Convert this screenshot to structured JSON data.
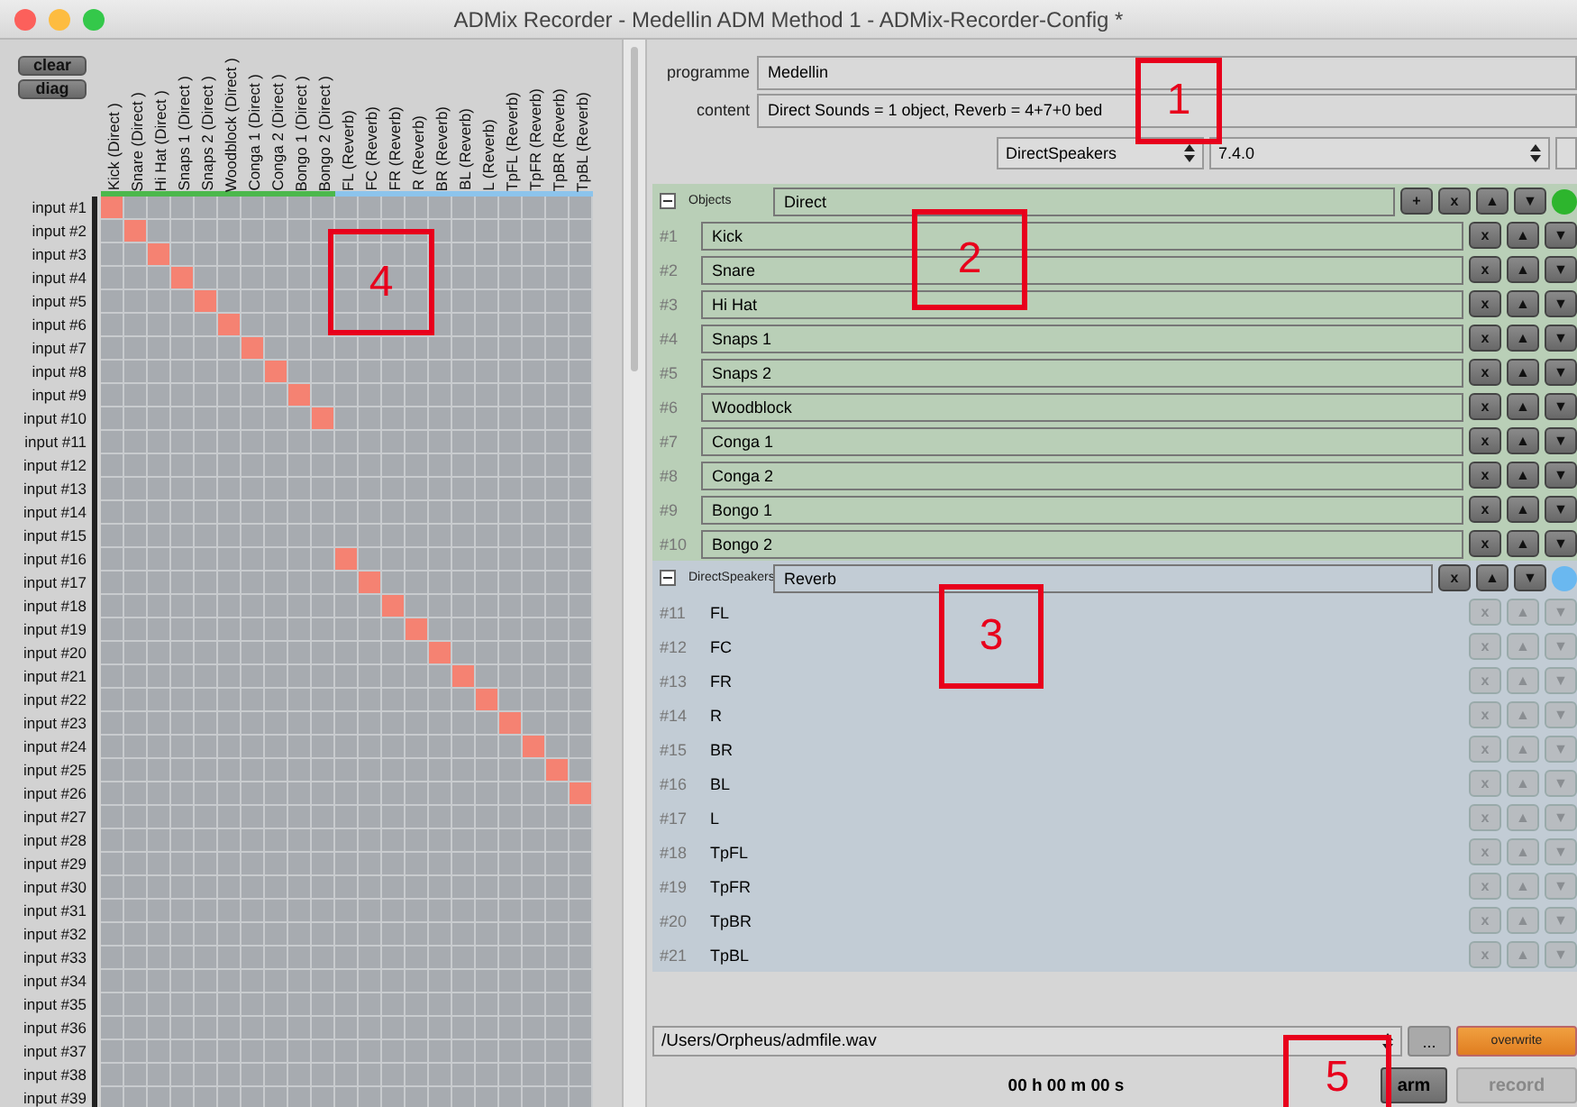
{
  "window": {
    "title": "ADMix Recorder - Medellin ADM Method 1 - ADMix-Recorder-Config *"
  },
  "matrix": {
    "buttons": [
      "clear",
      "diag"
    ],
    "columns": [
      {
        "label": "Kick (Direct )",
        "color": "#4cb84c"
      },
      {
        "label": "Snare (Direct )",
        "color": "#4cb84c"
      },
      {
        "label": "Hi Hat (Direct )",
        "color": "#4cb84c"
      },
      {
        "label": "Snaps 1 (Direct )",
        "color": "#4cb84c"
      },
      {
        "label": "Snaps 2 (Direct )",
        "color": "#4cb84c"
      },
      {
        "label": "Woodblock (Direct )",
        "color": "#4cb84c"
      },
      {
        "label": "Conga 1 (Direct )",
        "color": "#4cb84c"
      },
      {
        "label": "Conga 2 (Direct )",
        "color": "#4cb84c"
      },
      {
        "label": "Bongo 1 (Direct )",
        "color": "#4cb84c"
      },
      {
        "label": "Bongo 2 (Direct )",
        "color": "#4cb84c"
      },
      {
        "label": "FL (Reverb)",
        "color": "#8cc4ec"
      },
      {
        "label": "FC (Reverb)",
        "color": "#8cc4ec"
      },
      {
        "label": "FR (Reverb)",
        "color": "#8cc4ec"
      },
      {
        "label": "R (Reverb)",
        "color": "#8cc4ec"
      },
      {
        "label": "BR (Reverb)",
        "color": "#8cc4ec"
      },
      {
        "label": "BL (Reverb)",
        "color": "#8cc4ec"
      },
      {
        "label": "L (Reverb)",
        "color": "#8cc4ec"
      },
      {
        "label": "TpFL (Reverb)",
        "color": "#8cc4ec"
      },
      {
        "label": "TpFR (Reverb)",
        "color": "#8cc4ec"
      },
      {
        "label": "TpBR (Reverb)",
        "color": "#8cc4ec"
      },
      {
        "label": "TpBL (Reverb)",
        "color": "#8cc4ec"
      }
    ],
    "rows": [
      {
        "label": "input #1",
        "cells": [
          true,
          false,
          false,
          false,
          false,
          false,
          false,
          false,
          false,
          false,
          false,
          false,
          false,
          false,
          false,
          false,
          false,
          false,
          false,
          false,
          false
        ]
      },
      {
        "label": "input #2",
        "cells": [
          false,
          true,
          false,
          false,
          false,
          false,
          false,
          false,
          false,
          false,
          false,
          false,
          false,
          false,
          false,
          false,
          false,
          false,
          false,
          false,
          false
        ]
      },
      {
        "label": "input #3",
        "cells": [
          false,
          false,
          true,
          false,
          false,
          false,
          false,
          false,
          false,
          false,
          false,
          false,
          false,
          false,
          false,
          false,
          false,
          false,
          false,
          false,
          false
        ]
      },
      {
        "label": "input #4",
        "cells": [
          false,
          false,
          false,
          true,
          false,
          false,
          false,
          false,
          false,
          false,
          false,
          false,
          false,
          false,
          false,
          false,
          false,
          false,
          false,
          false,
          false
        ]
      },
      {
        "label": "input #5",
        "cells": [
          false,
          false,
          false,
          false,
          true,
          false,
          false,
          false,
          false,
          false,
          false,
          false,
          false,
          false,
          false,
          false,
          false,
          false,
          false,
          false,
          false
        ]
      },
      {
        "label": "input #6",
        "cells": [
          false,
          false,
          false,
          false,
          false,
          true,
          false,
          false,
          false,
          false,
          false,
          false,
          false,
          false,
          false,
          false,
          false,
          false,
          false,
          false,
          false
        ]
      },
      {
        "label": "input #7",
        "cells": [
          false,
          false,
          false,
          false,
          false,
          false,
          true,
          false,
          false,
          false,
          false,
          false,
          false,
          false,
          false,
          false,
          false,
          false,
          false,
          false,
          false
        ]
      },
      {
        "label": "input #8",
        "cells": [
          false,
          false,
          false,
          false,
          false,
          false,
          false,
          true,
          false,
          false,
          false,
          false,
          false,
          false,
          false,
          false,
          false,
          false,
          false,
          false,
          false
        ]
      },
      {
        "label": "input #9",
        "cells": [
          false,
          false,
          false,
          false,
          false,
          false,
          false,
          false,
          true,
          false,
          false,
          false,
          false,
          false,
          false,
          false,
          false,
          false,
          false,
          false,
          false
        ]
      },
      {
        "label": "input #10",
        "cells": [
          false,
          false,
          false,
          false,
          false,
          false,
          false,
          false,
          false,
          true,
          false,
          false,
          false,
          false,
          false,
          false,
          false,
          false,
          false,
          false,
          false
        ]
      },
      {
        "label": "input #11",
        "cells": [
          false,
          false,
          false,
          false,
          false,
          false,
          false,
          false,
          false,
          false,
          false,
          false,
          false,
          false,
          false,
          false,
          false,
          false,
          false,
          false,
          false
        ]
      },
      {
        "label": "input #12",
        "cells": [
          false,
          false,
          false,
          false,
          false,
          false,
          false,
          false,
          false,
          false,
          false,
          false,
          false,
          false,
          false,
          false,
          false,
          false,
          false,
          false,
          false
        ]
      },
      {
        "label": "input #13",
        "cells": [
          false,
          false,
          false,
          false,
          false,
          false,
          false,
          false,
          false,
          false,
          false,
          false,
          false,
          false,
          false,
          false,
          false,
          false,
          false,
          false,
          false
        ]
      },
      {
        "label": "input #14",
        "cells": [
          false,
          false,
          false,
          false,
          false,
          false,
          false,
          false,
          false,
          false,
          false,
          false,
          false,
          false,
          false,
          false,
          false,
          false,
          false,
          false,
          false
        ]
      },
      {
        "label": "input #15",
        "cells": [
          false,
          false,
          false,
          false,
          false,
          false,
          false,
          false,
          false,
          false,
          false,
          false,
          false,
          false,
          false,
          false,
          false,
          false,
          false,
          false,
          false
        ]
      },
      {
        "label": "input #16",
        "cells": [
          false,
          false,
          false,
          false,
          false,
          false,
          false,
          false,
          false,
          false,
          true,
          false,
          false,
          false,
          false,
          false,
          false,
          false,
          false,
          false,
          false
        ]
      },
      {
        "label": "input #17",
        "cells": [
          false,
          false,
          false,
          false,
          false,
          false,
          false,
          false,
          false,
          false,
          false,
          true,
          false,
          false,
          false,
          false,
          false,
          false,
          false,
          false,
          false
        ]
      },
      {
        "label": "input #18",
        "cells": [
          false,
          false,
          false,
          false,
          false,
          false,
          false,
          false,
          false,
          false,
          false,
          false,
          true,
          false,
          false,
          false,
          false,
          false,
          false,
          false,
          false
        ]
      },
      {
        "label": "input #19",
        "cells": [
          false,
          false,
          false,
          false,
          false,
          false,
          false,
          false,
          false,
          false,
          false,
          false,
          false,
          true,
          false,
          false,
          false,
          false,
          false,
          false,
          false
        ]
      },
      {
        "label": "input #20",
        "cells": [
          false,
          false,
          false,
          false,
          false,
          false,
          false,
          false,
          false,
          false,
          false,
          false,
          false,
          false,
          true,
          false,
          false,
          false,
          false,
          false,
          false
        ]
      },
      {
        "label": "input #21",
        "cells": [
          false,
          false,
          false,
          false,
          false,
          false,
          false,
          false,
          false,
          false,
          false,
          false,
          false,
          false,
          false,
          true,
          false,
          false,
          false,
          false,
          false
        ]
      },
      {
        "label": "input #22",
        "cells": [
          false,
          false,
          false,
          false,
          false,
          false,
          false,
          false,
          false,
          false,
          false,
          false,
          false,
          false,
          false,
          false,
          true,
          false,
          false,
          false,
          false
        ]
      },
      {
        "label": "input #23",
        "cells": [
          false,
          false,
          false,
          false,
          false,
          false,
          false,
          false,
          false,
          false,
          false,
          false,
          false,
          false,
          false,
          false,
          false,
          true,
          false,
          false,
          false
        ]
      },
      {
        "label": "input #24",
        "cells": [
          false,
          false,
          false,
          false,
          false,
          false,
          false,
          false,
          false,
          false,
          false,
          false,
          false,
          false,
          false,
          false,
          false,
          false,
          true,
          false,
          false
        ]
      },
      {
        "label": "input #25",
        "cells": [
          false,
          false,
          false,
          false,
          false,
          false,
          false,
          false,
          false,
          false,
          false,
          false,
          false,
          false,
          false,
          false,
          false,
          false,
          false,
          true,
          false
        ]
      },
      {
        "label": "input #26",
        "cells": [
          false,
          false,
          false,
          false,
          false,
          false,
          false,
          false,
          false,
          false,
          false,
          false,
          false,
          false,
          false,
          false,
          false,
          false,
          false,
          false,
          true
        ]
      },
      {
        "label": "input #27",
        "cells": [
          false,
          false,
          false,
          false,
          false,
          false,
          false,
          false,
          false,
          false,
          false,
          false,
          false,
          false,
          false,
          false,
          false,
          false,
          false,
          false,
          false
        ]
      },
      {
        "label": "input #28",
        "cells": [
          false,
          false,
          false,
          false,
          false,
          false,
          false,
          false,
          false,
          false,
          false,
          false,
          false,
          false,
          false,
          false,
          false,
          false,
          false,
          false,
          false
        ]
      },
      {
        "label": "input #29",
        "cells": [
          false,
          false,
          false,
          false,
          false,
          false,
          false,
          false,
          false,
          false,
          false,
          false,
          false,
          false,
          false,
          false,
          false,
          false,
          false,
          false,
          false
        ]
      },
      {
        "label": "input #30",
        "cells": [
          false,
          false,
          false,
          false,
          false,
          false,
          false,
          false,
          false,
          false,
          false,
          false,
          false,
          false,
          false,
          false,
          false,
          false,
          false,
          false,
          false
        ]
      },
      {
        "label": "input #31",
        "cells": [
          false,
          false,
          false,
          false,
          false,
          false,
          false,
          false,
          false,
          false,
          false,
          false,
          false,
          false,
          false,
          false,
          false,
          false,
          false,
          false,
          false
        ]
      },
      {
        "label": "input #32",
        "cells": [
          false,
          false,
          false,
          false,
          false,
          false,
          false,
          false,
          false,
          false,
          false,
          false,
          false,
          false,
          false,
          false,
          false,
          false,
          false,
          false,
          false
        ]
      },
      {
        "label": "input #33",
        "cells": [
          false,
          false,
          false,
          false,
          false,
          false,
          false,
          false,
          false,
          false,
          false,
          false,
          false,
          false,
          false,
          false,
          false,
          false,
          false,
          false,
          false
        ]
      },
      {
        "label": "input #34",
        "cells": [
          false,
          false,
          false,
          false,
          false,
          false,
          false,
          false,
          false,
          false,
          false,
          false,
          false,
          false,
          false,
          false,
          false,
          false,
          false,
          false,
          false
        ]
      },
      {
        "label": "input #35",
        "cells": [
          false,
          false,
          false,
          false,
          false,
          false,
          false,
          false,
          false,
          false,
          false,
          false,
          false,
          false,
          false,
          false,
          false,
          false,
          false,
          false,
          false
        ]
      },
      {
        "label": "input #36",
        "cells": [
          false,
          false,
          false,
          false,
          false,
          false,
          false,
          false,
          false,
          false,
          false,
          false,
          false,
          false,
          false,
          false,
          false,
          false,
          false,
          false,
          false
        ]
      },
      {
        "label": "input #37",
        "cells": [
          false,
          false,
          false,
          false,
          false,
          false,
          false,
          false,
          false,
          false,
          false,
          false,
          false,
          false,
          false,
          false,
          false,
          false,
          false,
          false,
          false
        ]
      },
      {
        "label": "input #38",
        "cells": [
          false,
          false,
          false,
          false,
          false,
          false,
          false,
          false,
          false,
          false,
          false,
          false,
          false,
          false,
          false,
          false,
          false,
          false,
          false,
          false,
          false
        ]
      },
      {
        "label": "input #39",
        "cells": [
          false,
          false,
          false,
          false,
          false,
          false,
          false,
          false,
          false,
          false,
          false,
          false,
          false,
          false,
          false,
          false,
          false,
          false,
          false,
          false,
          false
        ]
      }
    ]
  },
  "config": {
    "programme": {
      "label": "programme",
      "value": "Medellin"
    },
    "content": {
      "label": "content",
      "value": "Direct Sounds = 1 object,  Reverb = 4+7+0 bed"
    },
    "type_select": "DirectSpeakers",
    "layout_select": "7.4.0"
  },
  "groups": [
    {
      "kind": "objects",
      "label": "Objects",
      "name": "Direct",
      "expanded": true,
      "color": "#2db52d",
      "header_buttons": [
        "+",
        "x",
        "▲",
        "▼"
      ],
      "items_disabled": false,
      "items": [
        {
          "number": "#1",
          "name": "Kick",
          "buttons": [
            "x",
            "▲",
            "▼"
          ]
        },
        {
          "number": "#2",
          "name": "Snare",
          "buttons": [
            "x",
            "▲",
            "▼"
          ]
        },
        {
          "number": "#3",
          "name": "Hi Hat",
          "buttons": [
            "x",
            "▲",
            "▼"
          ]
        },
        {
          "number": "#4",
          "name": "Snaps 1",
          "buttons": [
            "x",
            "▲",
            "▼"
          ]
        },
        {
          "number": "#5",
          "name": "Snaps 2",
          "buttons": [
            "x",
            "▲",
            "▼"
          ]
        },
        {
          "number": "#6",
          "name": "Woodblock",
          "buttons": [
            "x",
            "▲",
            "▼"
          ]
        },
        {
          "number": "#7",
          "name": "Conga 1",
          "buttons": [
            "x",
            "▲",
            "▼"
          ]
        },
        {
          "number": "#8",
          "name": "Conga 2",
          "buttons": [
            "x",
            "▲",
            "▼"
          ]
        },
        {
          "number": "#9",
          "name": "Bongo 1",
          "buttons": [
            "x",
            "▲",
            "▼"
          ]
        },
        {
          "number": "#10",
          "name": "Bongo 2",
          "buttons": [
            "x",
            "▲",
            "▼"
          ]
        }
      ]
    },
    {
      "kind": "speakers",
      "label": "DirectSpeakers",
      "name": "Reverb",
      "expanded": true,
      "color": "#6ab8f0",
      "header_buttons": [
        "x",
        "▲",
        "▼"
      ],
      "items_disabled": true,
      "items": [
        {
          "number": "#11",
          "name": "FL",
          "buttons": [
            "x",
            "▲",
            "▼"
          ]
        },
        {
          "number": "#12",
          "name": "FC",
          "buttons": [
            "x",
            "▲",
            "▼"
          ]
        },
        {
          "number": "#13",
          "name": "FR",
          "buttons": [
            "x",
            "▲",
            "▼"
          ]
        },
        {
          "number": "#14",
          "name": "R",
          "buttons": [
            "x",
            "▲",
            "▼"
          ]
        },
        {
          "number": "#15",
          "name": "BR",
          "buttons": [
            "x",
            "▲",
            "▼"
          ]
        },
        {
          "number": "#16",
          "name": "BL",
          "buttons": [
            "x",
            "▲",
            "▼"
          ]
        },
        {
          "number": "#17",
          "name": "L",
          "buttons": [
            "x",
            "▲",
            "▼"
          ]
        },
        {
          "number": "#18",
          "name": "TpFL",
          "buttons": [
            "x",
            "▲",
            "▼"
          ]
        },
        {
          "number": "#19",
          "name": "TpFR",
          "buttons": [
            "x",
            "▲",
            "▼"
          ]
        },
        {
          "number": "#20",
          "name": "TpBR",
          "buttons": [
            "x",
            "▲",
            "▼"
          ]
        },
        {
          "number": "#21",
          "name": "TpBL",
          "buttons": [
            "x",
            "▲",
            "▼"
          ]
        }
      ]
    }
  ],
  "recorder": {
    "file": "/Users/Orpheus/admfile.wav",
    "browse": "...",
    "overwrite": "overwrite",
    "time": "00 h 00 m 00 s",
    "arm": "arm",
    "record": "record"
  },
  "annotations": [
    {
      "label": "1"
    },
    {
      "label": "2"
    },
    {
      "label": "3"
    },
    {
      "label": "4"
    },
    {
      "label": "5"
    }
  ]
}
